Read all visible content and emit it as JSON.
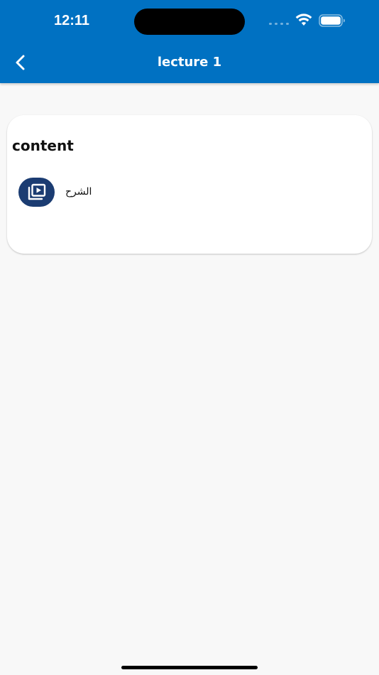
{
  "status_bar": {
    "time": "12:11"
  },
  "app_bar": {
    "title": "lecture 1",
    "back_icon": "chevron-left-icon",
    "background_color": "#0071c2"
  },
  "content_card": {
    "title": "content",
    "items": [
      {
        "label": "الشرح",
        "icon": "video-library-icon",
        "icon_background": "#1b3c72"
      }
    ]
  },
  "colors": {
    "page_background": "#f8f8f8",
    "card_background": "#ffffff",
    "text_primary": "#111111"
  }
}
